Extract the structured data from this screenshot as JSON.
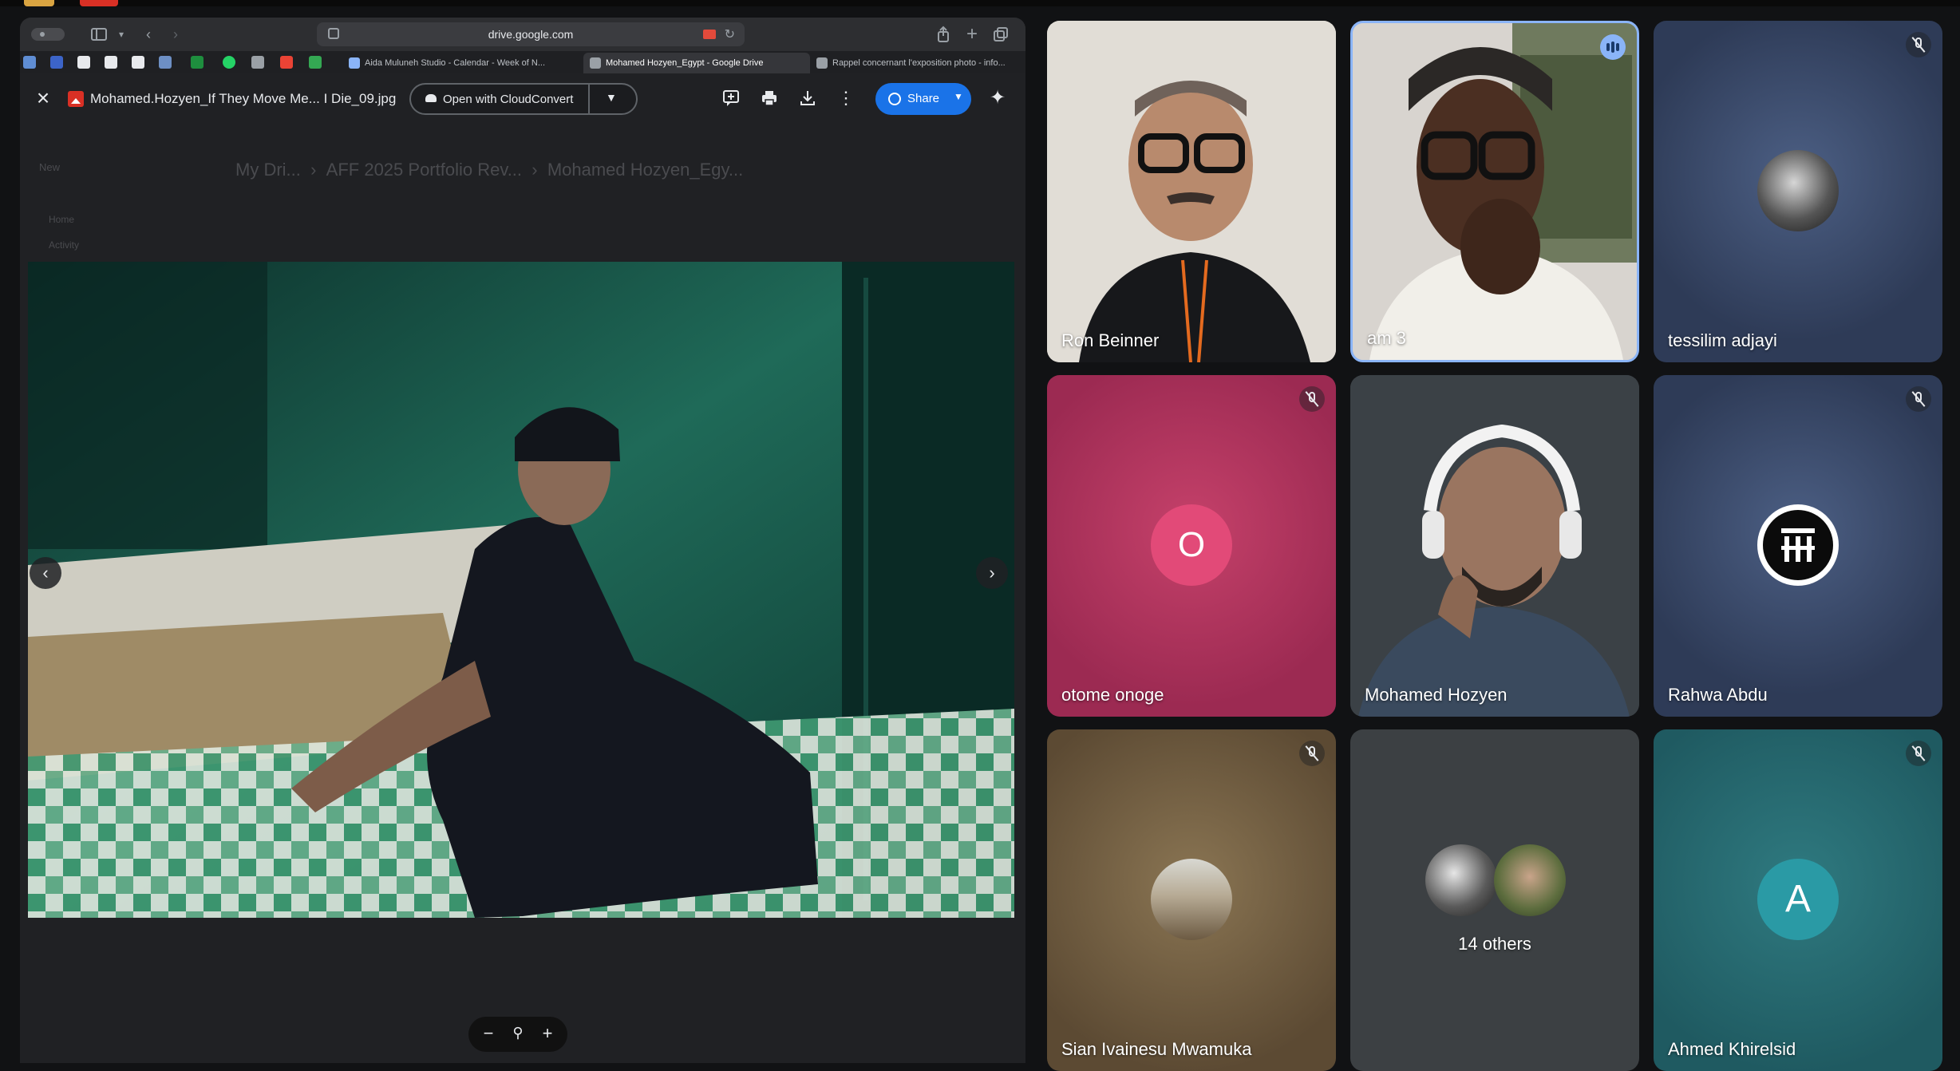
{
  "browser": {
    "url": "drive.google.com",
    "tabs": [
      {
        "label": "Aida Muluneh Studio - Calendar - Week of N..."
      },
      {
        "label": "Mohamed Hozyen_Egypt - Google Drive"
      },
      {
        "label": "Rappel concernant l'exposition photo - info..."
      }
    ]
  },
  "viewer": {
    "file_name": "Mohamed.Hozyen_If They Move Me... I Die_09.jpg",
    "open_with_label": "Open with CloudConvert",
    "share_label": "Share",
    "ghost_breadcrumb": [
      "My Dri...",
      "AFF 2025 Portfolio Rev...",
      "Mohamed Hozyen_Egy..."
    ],
    "ghost_new": "New",
    "ghost_home": "Home",
    "ghost_activity": "Activity",
    "zoom_icons": [
      "zoom-out-icon",
      "zoom-icon",
      "zoom-in-icon"
    ]
  },
  "meet": {
    "participants": [
      {
        "name": "Ron Beinner",
        "muted": false
      },
      {
        "name": "am 3",
        "muted": false,
        "speaking": true
      },
      {
        "name": "tessilim adjayi",
        "muted": true
      },
      {
        "name": "otome onoge",
        "muted": true,
        "initial": "O"
      },
      {
        "name": "Mohamed Hozyen",
        "muted": false
      },
      {
        "name": "Rahwa Abdu",
        "muted": true
      },
      {
        "name": "Sian Ivainesu Mwamuka",
        "muted": true
      },
      {
        "name": "14 others",
        "muted": false
      },
      {
        "name": "Ahmed Khirelsid",
        "muted": true,
        "initial": "A"
      }
    ]
  },
  "colors": {
    "accent": "#1a73e8",
    "otome_tile": "#b5315b",
    "otome_avatar": "#d93a6c",
    "ahmed_tile": "#2a6c73",
    "ahmed_avatar": "#2d8c95"
  }
}
